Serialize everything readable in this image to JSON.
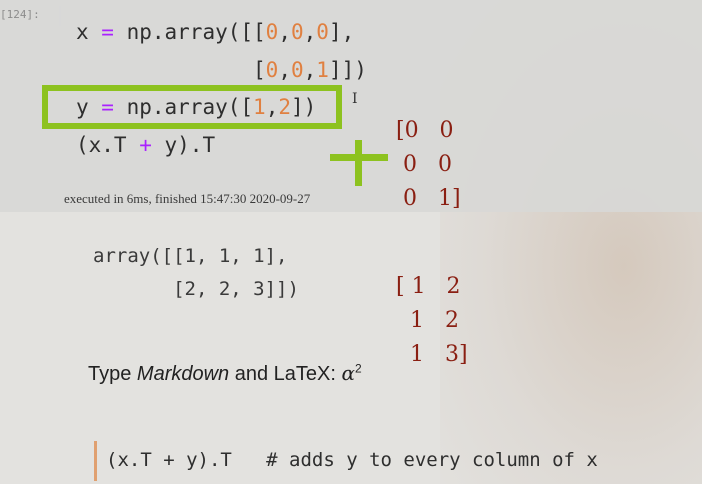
{
  "cell": {
    "prompt": "[124]:",
    "lines": [
      {
        "pre": "x ",
        "op": "=",
        "mid": " np.array([[",
        "n1": "0",
        "c1": ",",
        "n2": "0",
        "c2": ",",
        "n3": "0",
        "post": "],"
      },
      {
        "pre": "              [",
        "n1": "0",
        "c1": ",",
        "n2": "0",
        "c2": ",",
        "n3": "1",
        "post": "]])"
      },
      {
        "pre": "y ",
        "op": "=",
        "mid": " np.array([",
        "n1": "1",
        "c1": ",",
        "n2": "2",
        "post": "])"
      },
      {
        "pre": "(x.T ",
        "op": "+",
        "post": " y).T"
      }
    ],
    "status": "executed in 6ms, finished 15:47:30 2020-09-27"
  },
  "annotations": {
    "cursor": "I",
    "matrix_x": [
      "[0   0",
      " 0   0",
      " 0   1]"
    ],
    "matrix_y": [
      "[ 1   2",
      "  1   2",
      "  1   3]"
    ]
  },
  "output": {
    "lines": [
      "array([[1, 1, 1],",
      "       [2, 2, 3]])"
    ]
  },
  "markdown": {
    "prefix": "Type ",
    "emph": "Markdown",
    "mid": " and LaTeX: ",
    "alpha": "α",
    "sup": "2"
  },
  "edit_cell": {
    "code": "(x.T + y).T   # adds y to every column of x"
  },
  "colors": {
    "highlight": "#8dc21f",
    "annotation_ink": "#8a1f12",
    "number": "#e08040",
    "operator": "#aa22ff"
  }
}
